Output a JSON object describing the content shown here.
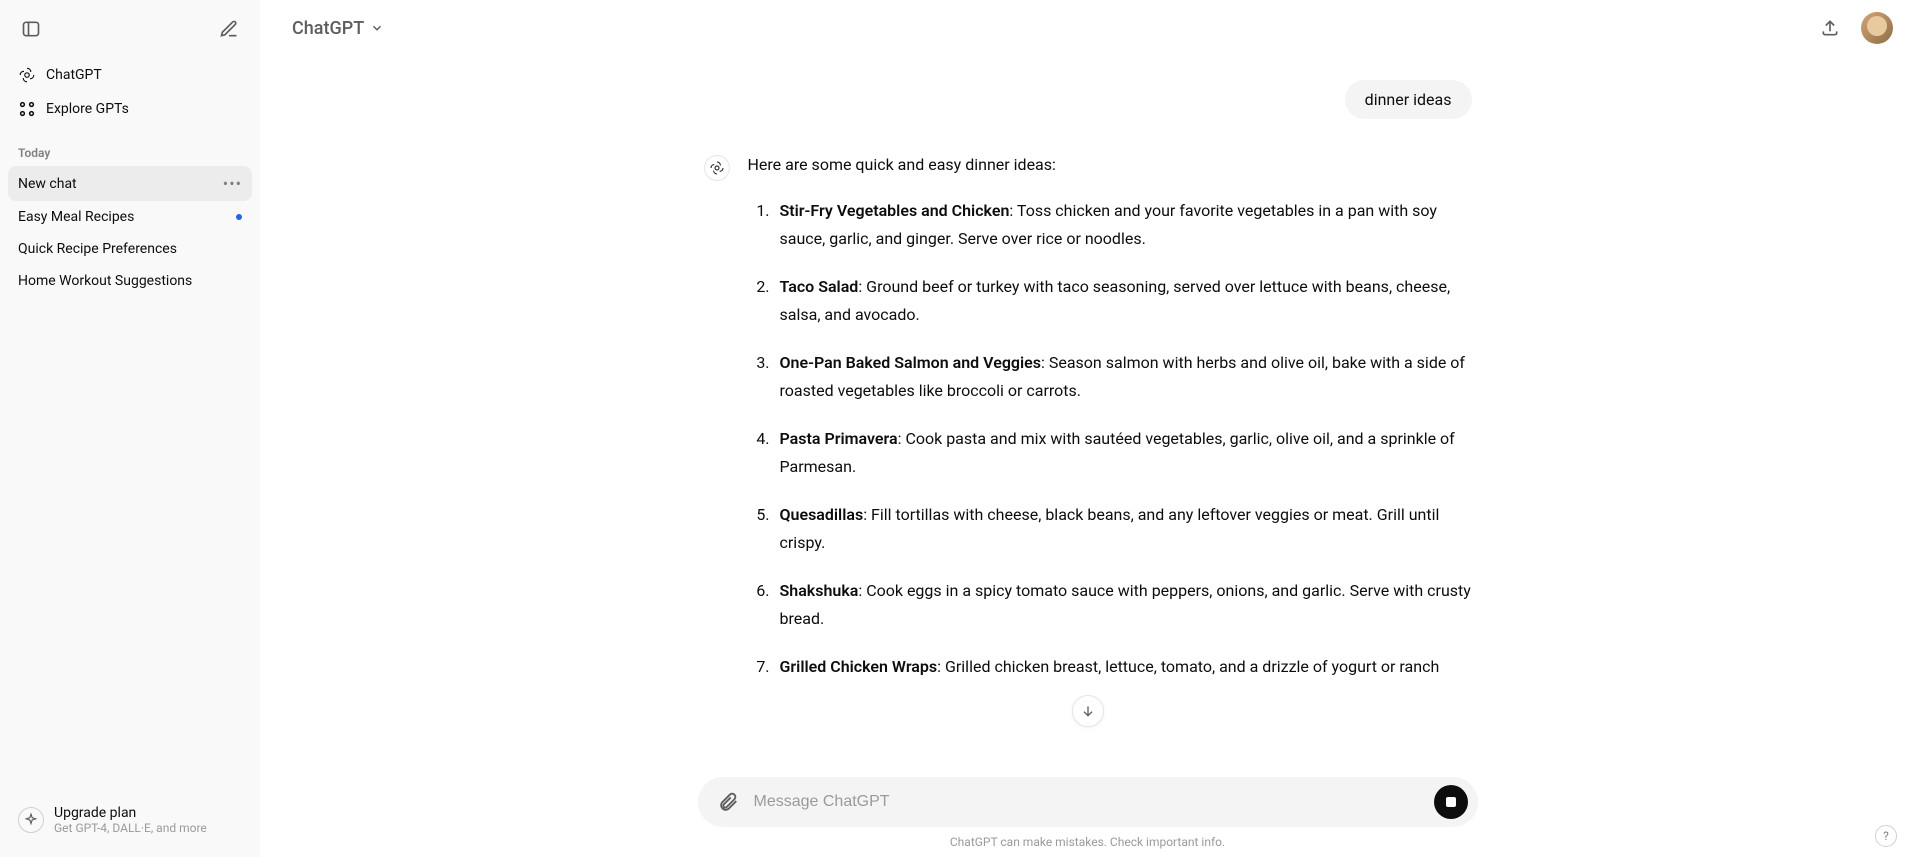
{
  "sidebar": {
    "nav": {
      "chatgpt": "ChatGPT",
      "explore": "Explore GPTs"
    },
    "section_today": "Today",
    "chats": [
      {
        "title": "New chat",
        "active": true,
        "has_dot": false
      },
      {
        "title": "Easy Meal Recipes",
        "active": false,
        "has_dot": true
      },
      {
        "title": "Quick Recipe Preferences",
        "active": false,
        "has_dot": false
      },
      {
        "title": "Home Workout Suggestions",
        "active": false,
        "has_dot": false
      }
    ],
    "upgrade": {
      "title": "Upgrade plan",
      "subtitle": "Get GPT-4, DALL·E, and more"
    }
  },
  "header": {
    "model": "ChatGPT"
  },
  "conversation": {
    "user_message": "dinner ideas",
    "assistant_intro": "Here are some quick and easy dinner ideas:",
    "ideas": [
      {
        "title": "Stir-Fry Vegetables and Chicken",
        "desc": ": Toss chicken and your favorite vegetables in a pan with soy sauce, garlic, and ginger. Serve over rice or noodles."
      },
      {
        "title": "Taco Salad",
        "desc": ": Ground beef or turkey with taco seasoning, served over lettuce with beans, cheese, salsa, and avocado."
      },
      {
        "title": "One-Pan Baked Salmon and Veggies",
        "desc": ": Season salmon with herbs and olive oil, bake with a side of roasted vegetables like broccoli or carrots."
      },
      {
        "title": "Pasta Primavera",
        "desc": ": Cook pasta and mix with sautéed vegetables, garlic, olive oil, and a sprinkle of Parmesan."
      },
      {
        "title": "Quesadillas",
        "desc": ": Fill tortillas with cheese, black beans, and any leftover veggies or meat. Grill until crispy."
      },
      {
        "title": "Shakshuka",
        "desc": ": Cook eggs in a spicy tomato sauce with peppers, onions, and garlic. Serve with crusty bread."
      },
      {
        "title": "Grilled Chicken Wraps",
        "desc": ": Grilled chicken breast, lettuce, tomato, and a drizzle of yogurt or ranch"
      }
    ]
  },
  "composer": {
    "placeholder": "Message ChatGPT"
  },
  "footer": {
    "disclaimer": "ChatGPT can make mistakes. Check important info.",
    "help": "?"
  }
}
